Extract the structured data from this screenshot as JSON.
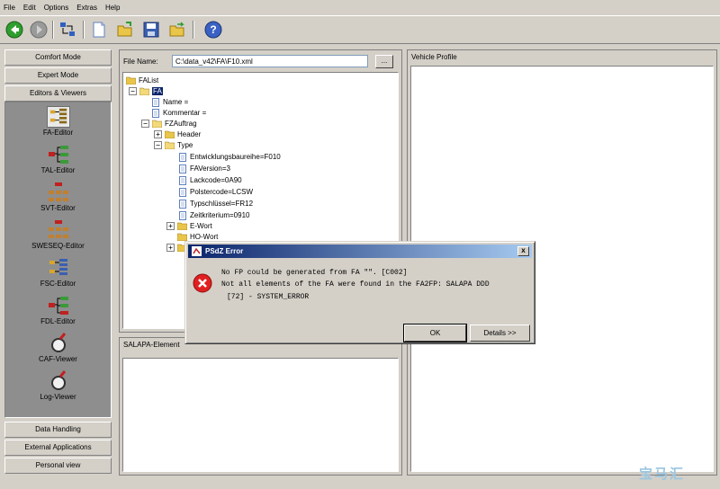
{
  "menu": [
    "File",
    "Edit",
    "Options",
    "Extras",
    "Help"
  ],
  "toolbar": {
    "icons": [
      "back-arrow-icon",
      "forward-arrow-icon",
      "transfer-icon",
      "new-document-icon",
      "open-folder-icon",
      "save-disk-icon",
      "export-folder-icon",
      "help-icon"
    ]
  },
  "sidebar": {
    "top_buttons": [
      "Comfort Mode",
      "Expert Mode",
      "Editors & Viewers"
    ],
    "tools": [
      {
        "label": "FA-Editor",
        "selected": true
      },
      {
        "label": "TAL-Editor"
      },
      {
        "label": "SVT-Editor"
      },
      {
        "label": "SWESEQ-Editor"
      },
      {
        "label": "FSC-Editor"
      },
      {
        "label": "FDL-Editor"
      },
      {
        "label": "CAF-Viewer"
      },
      {
        "label": "Log-Viewer"
      }
    ],
    "bottom_buttons": [
      "Data Handling",
      "External Applications",
      "Personal view"
    ]
  },
  "filepanel": {
    "label": "File Name:",
    "value": "C:\\data_v42\\FA\\F10.xml",
    "browse": "..."
  },
  "tree": {
    "root": "FAList",
    "fa": "FA",
    "name": "Name =",
    "kommentar": "Kommentar =",
    "fzauftrag": "FZAuftrag",
    "header": "Header",
    "type": "Type",
    "type_children": [
      "Entwicklungsbaureihe=F010",
      "FAVersion=3",
      "Lackcode=0A90",
      "Polstercode=LCSW",
      "Typschlüssel=FR12",
      "Zeitkriterium=0910"
    ],
    "eword": "E-Wort",
    "howord": "HO-Wort"
  },
  "salapa_title": "SALAPA-Element",
  "vehicle_profile_title": "Vehicle Profile",
  "dialog": {
    "title": "PSdZ Error",
    "close": "x",
    "lines": [
      "No FP could be generated from FA \"\". [C002]",
      "Not all elements of the FA were found in the FA2FP: SALAPA DDD",
      "[72] - SYSTEM_ERROR"
    ],
    "ok": "OK",
    "details": "Details >>"
  },
  "watermark": "宝马汇"
}
